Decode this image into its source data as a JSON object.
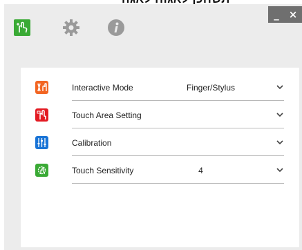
{
  "header_banner": "תשחכן לאגוח לאגה",
  "toolbar": {
    "touch_icon": "touch-hand-icon",
    "settings_icon": "gear-icon",
    "info_icon": "info-icon"
  },
  "window_controls": {
    "minimize": "_",
    "close": "×"
  },
  "settings": [
    {
      "label": "Interactive Mode",
      "value": "Finger/Stylus",
      "icon": "interactive-mode-icon",
      "icon_color": "#f26522"
    },
    {
      "label": "Touch Area Setting",
      "value": "",
      "icon": "touch-area-icon",
      "icon_color": "#e31b23"
    },
    {
      "label": "Calibration",
      "value": "",
      "icon": "calibration-icon",
      "icon_color": "#1a74d6"
    },
    {
      "label": "Touch Sensitivity",
      "value": "4",
      "icon": "touch-sensitivity-icon",
      "icon_color": "#3aaa35"
    }
  ],
  "colors": {
    "window_bg": "#ececec",
    "panel_bg": "#ffffff",
    "touch_green": "#3aaa35",
    "toolbar_grey": "#9a9a9a"
  }
}
